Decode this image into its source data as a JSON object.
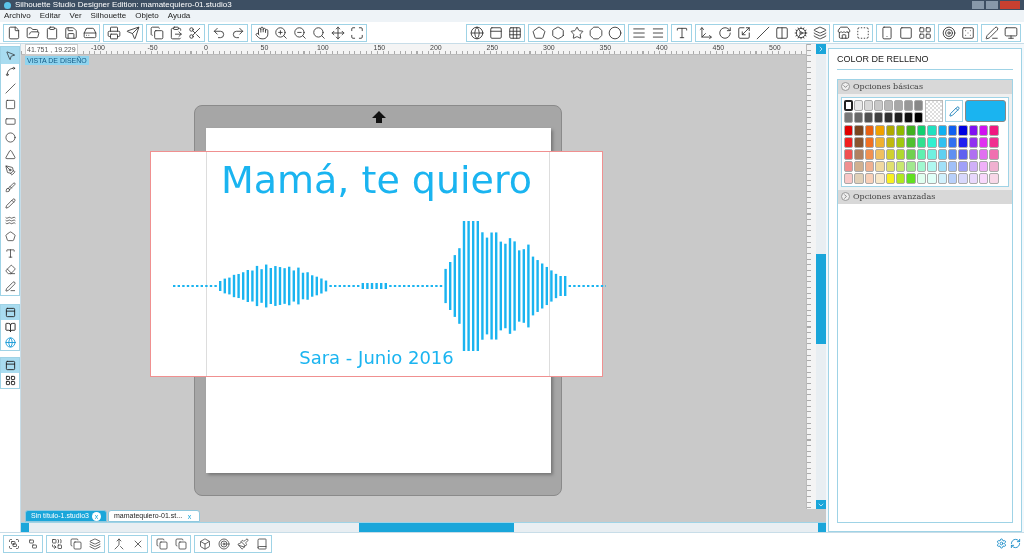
{
  "window": {
    "title": "Silhouette Studio Designer Edition: mamatequiero-01.studio3"
  },
  "menu": [
    "Archivo",
    "Editar",
    "Ver",
    "Silhouette",
    "Objeto",
    "Ayuda"
  ],
  "ruler": {
    "coordinates": "41.751 , 19.229",
    "labels": [
      "-100",
      "-50",
      "0",
      "50",
      "100",
      "150",
      "200",
      "250",
      "300",
      "350",
      "400",
      "450",
      "500"
    ]
  },
  "view_badge": "VISTA DE DISEÑO",
  "design": {
    "title": "Mamá, te quiero",
    "subtitle": "Sara - Junio 2016",
    "color": "#1ab4f0"
  },
  "left_tools": [
    {
      "kind": "select",
      "selected": true
    },
    {
      "kind": "nodes",
      "selected": false
    },
    {
      "kind": "line",
      "selected": false
    },
    {
      "kind": "rect",
      "selected": false
    },
    {
      "kind": "rounded",
      "selected": false
    },
    {
      "kind": "ellipse",
      "selected": false
    },
    {
      "kind": "polygon",
      "selected": false
    },
    {
      "kind": "curve",
      "selected": false
    },
    {
      "kind": "freehand",
      "selected": false
    },
    {
      "kind": "smooth",
      "selected": false
    },
    {
      "kind": "arc",
      "selected": false
    },
    {
      "kind": "pentagon",
      "selected": false
    },
    {
      "kind": "text",
      "selected": false
    },
    {
      "kind": "eraser",
      "selected": false
    },
    {
      "kind": "knife",
      "selected": false
    }
  ],
  "panel": {
    "title": "COLOR DE RELLENO",
    "sections": [
      {
        "label": "Opciones básicas",
        "expanded": true
      },
      {
        "label": "Opciones avanzadas",
        "expanded": false
      }
    ],
    "grays": [
      [
        {
          "color": "#ffffff",
          "selected": true
        },
        {
          "color": "#e8e8e8",
          "selected": false
        },
        {
          "color": "#d8d8d8",
          "selected": false
        },
        {
          "color": "#c8c8c8",
          "selected": false
        },
        {
          "color": "#b8b8b8",
          "selected": false
        },
        {
          "color": "#a8a8a8",
          "selected": false
        },
        {
          "color": "#989898",
          "selected": false
        },
        {
          "color": "#888888",
          "selected": false
        }
      ],
      [
        {
          "color": "#787878",
          "selected": false
        },
        {
          "color": "#686868",
          "selected": false
        },
        {
          "color": "#505050",
          "selected": false
        },
        {
          "color": "#404040",
          "selected": false
        },
        {
          "color": "#303030",
          "selected": false
        },
        {
          "color": "#202020",
          "selected": false
        },
        {
          "color": "#101010",
          "selected": false
        },
        {
          "color": "#000000",
          "selected": false
        }
      ]
    ],
    "colors": [
      [
        {
          "color": "#e00000",
          "selected": false
        },
        {
          "color": "#7a4520",
          "selected": false
        },
        {
          "color": "#e86010",
          "selected": false
        },
        {
          "color": "#f0a000",
          "selected": false
        },
        {
          "color": "#b0a800",
          "selected": false
        },
        {
          "color": "#90b800",
          "selected": false
        },
        {
          "color": "#40b020",
          "selected": false
        },
        {
          "color": "#10d070",
          "selected": false
        },
        {
          "color": "#20e0c0",
          "selected": false
        },
        {
          "color": "#10b0f0",
          "selected": false
        },
        {
          "color": "#1060f0",
          "selected": false
        },
        {
          "color": "#0000e0",
          "selected": false
        },
        {
          "color": "#8010f0",
          "selected": false
        },
        {
          "color": "#d010f0",
          "selected": false
        },
        {
          "color": "#f01880",
          "selected": false
        }
      ],
      [
        {
          "color": "#f02020",
          "selected": false
        },
        {
          "color": "#8a5530",
          "selected": false
        },
        {
          "color": "#f07020",
          "selected": false
        },
        {
          "color": "#f0b030",
          "selected": false
        },
        {
          "color": "#c0b810",
          "selected": false
        },
        {
          "color": "#a0c810",
          "selected": false
        },
        {
          "color": "#50c030",
          "selected": false
        },
        {
          "color": "#30e090",
          "selected": false
        },
        {
          "color": "#30f0d0",
          "selected": false
        },
        {
          "color": "#30c0f0",
          "selected": false
        },
        {
          "color": "#3070f0",
          "selected": false
        },
        {
          "color": "#2020f0",
          "selected": false
        },
        {
          "color": "#9030f0",
          "selected": false
        },
        {
          "color": "#e030f0",
          "selected": false
        },
        {
          "color": "#f03090",
          "selected": false
        }
      ],
      [
        {
          "color": "#f05050",
          "selected": false
        },
        {
          "color": "#b08060",
          "selected": false
        },
        {
          "color": "#f09050",
          "selected": false
        },
        {
          "color": "#f0c060",
          "selected": false
        },
        {
          "color": "#d0d030",
          "selected": false
        },
        {
          "color": "#b0d830",
          "selected": false
        },
        {
          "color": "#70d050",
          "selected": false
        },
        {
          "color": "#60f0b0",
          "selected": false
        },
        {
          "color": "#70f0e0",
          "selected": false
        },
        {
          "color": "#60d0f0",
          "selected": false
        },
        {
          "color": "#6090f0",
          "selected": false
        },
        {
          "color": "#6060f0",
          "selected": false
        },
        {
          "color": "#b070f0",
          "selected": false
        },
        {
          "color": "#e070f0",
          "selected": false
        },
        {
          "color": "#f070b0",
          "selected": false
        }
      ],
      [
        {
          "color": "#f09090",
          "selected": false
        },
        {
          "color": "#d0b090",
          "selected": false
        },
        {
          "color": "#f0b090",
          "selected": false
        },
        {
          "color": "#f0d8a0",
          "selected": false
        },
        {
          "color": "#e0e070",
          "selected": false
        },
        {
          "color": "#c8e870",
          "selected": false
        },
        {
          "color": "#a0e890",
          "selected": false
        },
        {
          "color": "#a0f8d0",
          "selected": false
        },
        {
          "color": "#b0f8f0",
          "selected": false
        },
        {
          "color": "#a0e0f8",
          "selected": false
        },
        {
          "color": "#a0c0f8",
          "selected": false
        },
        {
          "color": "#a0a0f8",
          "selected": false
        },
        {
          "color": "#d0b0f8",
          "selected": false
        },
        {
          "color": "#f0b0f8",
          "selected": false
        },
        {
          "color": "#f0b0d0",
          "selected": false
        }
      ],
      [
        {
          "color": "#f8c8c8",
          "selected": false
        },
        {
          "color": "#e0d0b8",
          "selected": false
        },
        {
          "color": "#f8d0b8",
          "selected": false
        },
        {
          "color": "#f8e8c8",
          "selected": false
        },
        {
          "color": "#f8f020",
          "selected": false
        },
        {
          "color": "#b0e820",
          "selected": false
        },
        {
          "color": "#60e020",
          "selected": false
        },
        {
          "color": "#e0fff0",
          "selected": false
        },
        {
          "color": "#e0fff8",
          "selected": false
        },
        {
          "color": "#d0f0fc",
          "selected": false
        },
        {
          "color": "#b8d0fa",
          "selected": false
        },
        {
          "color": "#d8d8fc",
          "selected": false
        },
        {
          "color": "#e8d8fc",
          "selected": false
        },
        {
          "color": "#f8d8fc",
          "selected": false
        },
        {
          "color": "#f8d8e8",
          "selected": false
        }
      ]
    ]
  },
  "tabs": [
    {
      "label": "Sin título-1.studio3",
      "close": "x",
      "selected": false
    },
    {
      "label": "mamatequiero-01.st...",
      "close": "x",
      "selected": true
    }
  ]
}
